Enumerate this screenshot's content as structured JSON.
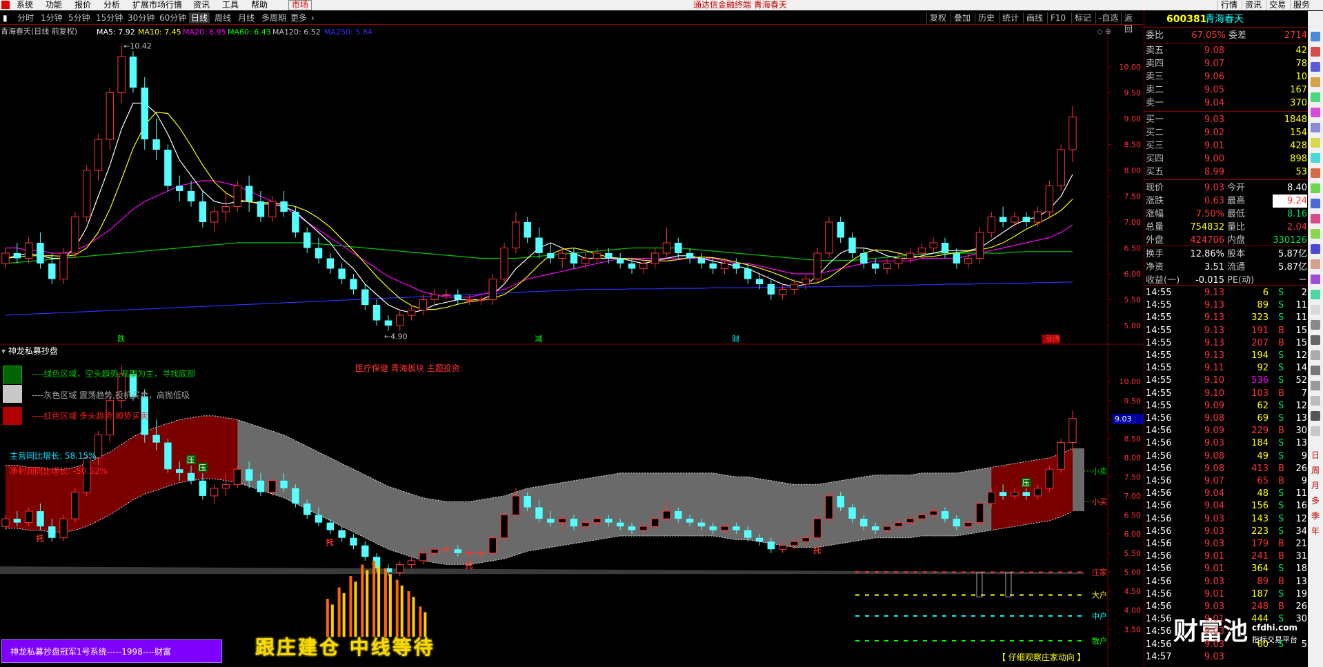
{
  "menubar": {
    "items": [
      "系统",
      "功能",
      "报价",
      "分析",
      "扩展市场行情",
      "资讯",
      "工具",
      "帮助",
      "市场"
    ],
    "title": "通达信金融终端 青海春天",
    "right_items": [
      "行情",
      "资讯",
      "交易",
      "服务"
    ]
  },
  "periodbar": {
    "periods": [
      "分时",
      "1分钟",
      "5分钟",
      "15分钟",
      "30分钟",
      "60分钟",
      "日线",
      "周线",
      "月线",
      "多周期",
      "更多"
    ],
    "active": "日线",
    "tools": [
      "复权",
      "叠加",
      "历史",
      "统计",
      "画线",
      "F10",
      "标记",
      "-自选",
      "返回"
    ]
  },
  "upper": {
    "stock_title": "青海春天(日线 前复权)",
    "ma": [
      {
        "label": "MA5: 7.92",
        "color": "#ffffff"
      },
      {
        "label": "MA10: 7.45",
        "color": "#ffff00"
      },
      {
        "label": "MA20: 6.95",
        "color": "#ff00ff"
      },
      {
        "label": "MA60: 6.43",
        "color": "#00ff00"
      },
      {
        "label": "MA120: 6.52",
        "color": "#c0c0c0"
      },
      {
        "label": "MA250: 5.84",
        "color": "#3030ff"
      }
    ],
    "axis": [
      "10.00",
      "9.50",
      "9.00",
      "8.50",
      "8.00",
      "7.50",
      "7.00",
      "6.50",
      "6.00",
      "5.50",
      "5.00"
    ],
    "high_label": "10.42",
    "low_label": "4.90",
    "signals": [
      {
        "text": "跌",
        "color": "#00ff00"
      },
      {
        "text": "减",
        "color": "#00ff00"
      },
      {
        "text": "财",
        "color": "#00ffff"
      },
      {
        "text": "涨腾",
        "color": "#ff3333"
      }
    ]
  },
  "lower": {
    "indicator_name": "神龙私募抄盘",
    "sector_note": "医疗保健 青海板块 主题投资:",
    "legend": [
      {
        "text": "----绿色区域，空头趋势,观望为主，寻找底部",
        "color": "#00c800",
        "swatch": "#006400"
      },
      {
        "text": "----灰色区域 震荡趋势,投机买卖，高抛低吸",
        "color": "#a0a0a0",
        "swatch": "#c8c8c8"
      },
      {
        "text": "----红色区域 多头趋势,顺势买卖",
        "color": "#ff2020",
        "swatch": "#b00000"
      }
    ],
    "growth1": "主营同比增长: 58.15%",
    "growth2": "净利润同比增长: -50.52%",
    "axis": [
      "10.00",
      "9.50",
      "9.00",
      "8.50",
      "8.00",
      "7.50",
      "7.00",
      "6.50",
      "6.00",
      "5.50",
      "5.00",
      "4.50",
      "4.00",
      "3.50"
    ],
    "price_tag": "9.03",
    "band_labels": [
      "小卖",
      "小买",
      "庄家",
      "大户",
      "中户",
      "散户"
    ],
    "marks_tuo": [
      "托",
      "托",
      "托",
      "托"
    ],
    "marks_ya": [
      "压",
      "压",
      "压"
    ],
    "banner_left": "神龙私募抄盘冠军1号系统-----1998----财富",
    "banner_mid": "跟庄建仓 中线等待",
    "bottom_note": "【 仔细观察庄家动向 】"
  },
  "quote": {
    "code": "600381",
    "name": "青海春天",
    "weibi_label": "委比",
    "weibi": "67.05%",
    "weicha_label": "委差",
    "weicha": "2714",
    "sell": [
      {
        "label": "卖五",
        "price": "9.08",
        "vol": "42"
      },
      {
        "label": "卖四",
        "price": "9.07",
        "vol": "78"
      },
      {
        "label": "卖三",
        "price": "9.06",
        "vol": "10"
      },
      {
        "label": "卖二",
        "price": "9.05",
        "vol": "167"
      },
      {
        "label": "卖一",
        "price": "9.04",
        "vol": "370"
      }
    ],
    "buy": [
      {
        "label": "买一",
        "price": "9.03",
        "vol": "1848"
      },
      {
        "label": "买二",
        "price": "9.02",
        "vol": "154"
      },
      {
        "label": "买三",
        "price": "9.01",
        "vol": "428"
      },
      {
        "label": "买四",
        "price": "9.00",
        "vol": "898"
      },
      {
        "label": "买五",
        "price": "8.99",
        "vol": "53"
      }
    ],
    "stats": [
      {
        "l1": "现价",
        "v1": "9.03",
        "c1": "#ff3333",
        "l2": "今开",
        "v2": "8.40",
        "c2": "#ffffff"
      },
      {
        "l1": "涨跌",
        "v1": "0.63",
        "c1": "#ff3333",
        "l2": "最高",
        "v2": "9.24",
        "c2": "#ff3333"
      },
      {
        "l1": "涨幅",
        "v1": "7.50%",
        "c1": "#ff3333",
        "l2": "最低",
        "v2": "8.16",
        "c2": "#00e060"
      },
      {
        "l1": "总量",
        "v1": "754832",
        "c1": "#ffff00",
        "l2": "量比",
        "v2": "2.04",
        "c2": "#ff3333"
      },
      {
        "l1": "外盘",
        "v1": "424706",
        "c1": "#ff3333",
        "l2": "内盘",
        "v2": "330126",
        "c2": "#00e060"
      }
    ],
    "stats2": [
      {
        "l1": "换手",
        "v1": "12.86%",
        "l2": "股本",
        "v2": "5.87亿"
      },
      {
        "l1": "净资",
        "v1": "3.51",
        "l2": "流通",
        "v2": "5.87亿"
      },
      {
        "l1": "收益(一)",
        "v1": "-0.015",
        "l2": "PE(动)",
        "v2": "－"
      }
    ],
    "ticks": [
      [
        "14:55",
        "9.13",
        "6",
        "S",
        "2"
      ],
      [
        "14:55",
        "9.13",
        "89",
        "S",
        "11"
      ],
      [
        "14:55",
        "9.13",
        "323",
        "S",
        "11"
      ],
      [
        "14:55",
        "9.13",
        "191",
        "B",
        "15"
      ],
      [
        "14:55",
        "9.13",
        "207",
        "B",
        "15"
      ],
      [
        "14:55",
        "9.13",
        "194",
        "S",
        "12"
      ],
      [
        "14:55",
        "9.11",
        "92",
        "S",
        "14"
      ],
      [
        "14:55",
        "9.10",
        "536",
        "S",
        "52"
      ],
      [
        "14:55",
        "9.10",
        "103",
        "B",
        "7"
      ],
      [
        "14:55",
        "9.09",
        "62",
        "S",
        "12"
      ],
      [
        "14:56",
        "9.08",
        "69",
        "S",
        "13"
      ],
      [
        "14:56",
        "9.09",
        "229",
        "B",
        "30"
      ],
      [
        "14:56",
        "9.03",
        "184",
        "S",
        "13"
      ],
      [
        "14:56",
        "9.08",
        "49",
        "S",
        "9"
      ],
      [
        "14:56",
        "9.08",
        "413",
        "B",
        "26"
      ],
      [
        "14:56",
        "9.07",
        "65",
        "B",
        "9"
      ],
      [
        "14:56",
        "9.04",
        "48",
        "S",
        "11"
      ],
      [
        "14:56",
        "9.04",
        "156",
        "S",
        "16"
      ],
      [
        "14:56",
        "9.03",
        "143",
        "S",
        "12"
      ],
      [
        "14:56",
        "9.03",
        "223",
        "S",
        "34"
      ],
      [
        "14:56",
        "9.03",
        "179",
        "B",
        "21"
      ],
      [
        "14:56",
        "9.01",
        "241",
        "B",
        "31"
      ],
      [
        "14:56",
        "9.01",
        "364",
        "S",
        "18"
      ],
      [
        "14:56",
        "9.03",
        "89",
        "B",
        "13"
      ],
      [
        "14:56",
        "9.01",
        "187",
        "S",
        "19"
      ],
      [
        "14:56",
        "9.03",
        "248",
        "B",
        "26"
      ],
      [
        "14:56",
        "9.01",
        "444",
        "S",
        "30"
      ],
      [
        "14:56",
        "9.03",
        "",
        "",
        ""
      ],
      [
        "14:56",
        "9.03",
        "60",
        "S",
        "5"
      ],
      [
        "14:57",
        "9.03",
        "",
        "",
        ""
      ]
    ],
    "watermark": "财富池",
    "watermark_url": "cfdhi.com",
    "watermark_sub": "指标交易平台"
  },
  "sidebar": {
    "labels": [
      "日",
      "周",
      "月",
      "多",
      "季",
      "年"
    ]
  },
  "colors": {
    "up": "#ff3333",
    "down": "#54ffff",
    "grid_red": "#800000",
    "red_zone": "#7a0000",
    "gray_zone": "#6a6a6a"
  },
  "chart_data": {
    "type": "candlestick",
    "y_range": [
      4.8,
      10.6
    ],
    "candles": [
      [
        6.2,
        6.5,
        6.1,
        6.4
      ],
      [
        6.4,
        6.6,
        6.2,
        6.3
      ],
      [
        6.3,
        6.7,
        6.2,
        6.6
      ],
      [
        6.6,
        6.8,
        6.1,
        6.2
      ],
      [
        6.2,
        6.4,
        5.8,
        5.9
      ],
      [
        5.9,
        6.5,
        5.8,
        6.4
      ],
      [
        6.4,
        7.2,
        6.3,
        7.1
      ],
      [
        7.1,
        8.1,
        7.0,
        8.0
      ],
      [
        8.0,
        8.7,
        7.8,
        8.6
      ],
      [
        8.6,
        9.6,
        8.4,
        9.5
      ],
      [
        9.5,
        10.42,
        9.3,
        10.2
      ],
      [
        10.2,
        10.3,
        9.5,
        9.6
      ],
      [
        9.6,
        9.8,
        8.4,
        8.6
      ],
      [
        8.6,
        9.0,
        8.2,
        8.4
      ],
      [
        8.4,
        8.5,
        7.6,
        7.7
      ],
      [
        7.7,
        7.9,
        7.4,
        7.6
      ],
      [
        7.6,
        7.8,
        7.3,
        7.4
      ],
      [
        7.4,
        7.6,
        6.9,
        7.0
      ],
      [
        7.0,
        7.3,
        6.8,
        7.2
      ],
      [
        7.2,
        7.6,
        7.0,
        7.3
      ],
      [
        7.3,
        7.8,
        7.2,
        7.7
      ],
      [
        7.7,
        7.9,
        7.2,
        7.4
      ],
      [
        7.4,
        7.6,
        7.0,
        7.1
      ],
      [
        7.1,
        7.5,
        7.0,
        7.4
      ],
      [
        7.4,
        7.6,
        7.1,
        7.2
      ],
      [
        7.2,
        7.3,
        6.7,
        6.8
      ],
      [
        6.8,
        6.9,
        6.4,
        6.5
      ],
      [
        6.5,
        6.7,
        6.2,
        6.3
      ],
      [
        6.3,
        6.4,
        6.0,
        6.1
      ],
      [
        6.1,
        6.2,
        5.8,
        5.9
      ],
      [
        5.9,
        6.0,
        5.6,
        5.7
      ],
      [
        5.7,
        5.8,
        5.3,
        5.4
      ],
      [
        5.4,
        5.5,
        5.0,
        5.1
      ],
      [
        5.1,
        5.2,
        4.9,
        5.0
      ],
      [
        5.0,
        5.3,
        4.9,
        5.2
      ],
      [
        5.2,
        5.4,
        5.1,
        5.3
      ],
      [
        5.3,
        5.6,
        5.2,
        5.5
      ],
      [
        5.5,
        5.7,
        5.4,
        5.6
      ],
      [
        5.6,
        5.7,
        5.5,
        5.6
      ],
      [
        5.6,
        5.7,
        5.4,
        5.5
      ],
      [
        5.5,
        5.6,
        5.4,
        5.5
      ],
      [
        5.5,
        5.6,
        5.4,
        5.5
      ],
      [
        5.5,
        6.0,
        5.4,
        5.9
      ],
      [
        5.9,
        6.6,
        5.8,
        6.5
      ],
      [
        6.5,
        7.2,
        6.4,
        7.0
      ],
      [
        7.0,
        7.1,
        6.6,
        6.7
      ],
      [
        6.7,
        6.9,
        6.3,
        6.4
      ],
      [
        6.4,
        6.6,
        6.2,
        6.3
      ],
      [
        6.3,
        6.5,
        6.1,
        6.4
      ],
      [
        6.4,
        6.5,
        6.1,
        6.2
      ],
      [
        6.2,
        6.4,
        6.1,
        6.3
      ],
      [
        6.3,
        6.5,
        6.2,
        6.4
      ],
      [
        6.4,
        6.5,
        6.2,
        6.3
      ],
      [
        6.3,
        6.4,
        6.1,
        6.2
      ],
      [
        6.2,
        6.3,
        6.0,
        6.1
      ],
      [
        6.1,
        6.3,
        6.0,
        6.2
      ],
      [
        6.2,
        6.5,
        6.1,
        6.4
      ],
      [
        6.4,
        6.9,
        6.3,
        6.6
      ],
      [
        6.6,
        6.7,
        6.3,
        6.4
      ],
      [
        6.4,
        6.5,
        6.2,
        6.3
      ],
      [
        6.3,
        6.4,
        6.1,
        6.2
      ],
      [
        6.2,
        6.3,
        6.0,
        6.1
      ],
      [
        6.1,
        6.3,
        6.0,
        6.2
      ],
      [
        6.2,
        6.3,
        6.0,
        6.1
      ],
      [
        6.1,
        6.2,
        5.8,
        5.9
      ],
      [
        5.9,
        6.0,
        5.7,
        5.8
      ],
      [
        5.8,
        5.9,
        5.5,
        5.6
      ],
      [
        5.6,
        5.8,
        5.5,
        5.7
      ],
      [
        5.7,
        5.9,
        5.6,
        5.8
      ],
      [
        5.8,
        6.0,
        5.7,
        5.9
      ],
      [
        5.9,
        6.5,
        5.8,
        6.4
      ],
      [
        6.4,
        7.1,
        6.3,
        7.0
      ],
      [
        7.0,
        7.1,
        6.6,
        6.7
      ],
      [
        6.7,
        6.8,
        6.3,
        6.4
      ],
      [
        6.4,
        6.5,
        6.1,
        6.2
      ],
      [
        6.2,
        6.3,
        6.0,
        6.1
      ],
      [
        6.1,
        6.3,
        6.0,
        6.2
      ],
      [
        6.2,
        6.4,
        6.1,
        6.3
      ],
      [
        6.3,
        6.5,
        6.2,
        6.4
      ],
      [
        6.4,
        6.6,
        6.3,
        6.5
      ],
      [
        6.5,
        6.7,
        6.4,
        6.6
      ],
      [
        6.6,
        6.7,
        6.3,
        6.4
      ],
      [
        6.4,
        6.5,
        6.1,
        6.2
      ],
      [
        6.2,
        6.4,
        6.1,
        6.3
      ],
      [
        6.3,
        6.9,
        6.2,
        6.8
      ],
      [
        6.8,
        7.2,
        6.7,
        7.1
      ],
      [
        7.1,
        7.3,
        6.9,
        7.0
      ],
      [
        7.0,
        7.2,
        6.9,
        7.1
      ],
      [
        7.1,
        7.2,
        6.9,
        7.0
      ],
      [
        7.0,
        7.3,
        6.9,
        7.2
      ],
      [
        7.2,
        7.8,
        7.1,
        7.7
      ],
      [
        7.7,
        8.5,
        7.6,
        8.4
      ],
      [
        8.4,
        9.24,
        8.16,
        9.03
      ]
    ],
    "ma5": [
      6.3,
      6.35,
      6.4,
      6.35,
      6.3,
      6.3,
      6.5,
      6.9,
      7.5,
      8.1,
      8.8,
      9.3,
      9.3,
      9.1,
      8.7,
      8.2,
      7.9,
      7.6,
      7.4,
      7.35,
      7.4,
      7.4,
      7.35,
      7.35,
      7.3,
      7.2,
      7.0,
      6.8,
      6.6,
      6.3,
      6.1,
      5.8,
      5.6,
      5.4,
      5.3,
      5.25,
      5.3,
      5.4,
      5.45,
      5.5,
      5.5,
      5.5,
      5.6,
      5.8,
      6.1,
      6.3,
      6.5,
      6.6,
      6.5,
      6.4,
      6.3,
      6.3,
      6.3,
      6.3,
      6.25,
      6.2,
      6.25,
      6.3,
      6.35,
      6.35,
      6.3,
      6.25,
      6.2,
      6.15,
      6.1,
      6.0,
      5.9,
      5.8,
      5.75,
      5.8,
      5.95,
      6.2,
      6.4,
      6.5,
      6.5,
      6.45,
      6.35,
      6.3,
      6.3,
      6.35,
      6.4,
      6.45,
      6.45,
      6.45,
      6.5,
      6.65,
      6.8,
      6.95,
      7.05,
      7.1,
      7.25,
      7.5,
      7.92
    ],
    "ma20": [
      6.5,
      6.5,
      6.45,
      6.45,
      6.4,
      6.4,
      6.45,
      6.55,
      6.7,
      6.85,
      7.05,
      7.25,
      7.4,
      7.5,
      7.6,
      7.7,
      7.75,
      7.8,
      7.8,
      7.75,
      7.7,
      7.6,
      7.5,
      7.4,
      7.3,
      7.15,
      7.0,
      6.85,
      6.7,
      6.55,
      6.4,
      6.25,
      6.1,
      5.95,
      5.85,
      5.75,
      5.65,
      5.6,
      5.55,
      5.55,
      5.55,
      5.6,
      5.65,
      5.7,
      5.8,
      5.9,
      5.95,
      6.0,
      6.05,
      6.1,
      6.15,
      6.2,
      6.25,
      6.3,
      6.3,
      6.3,
      6.3,
      6.3,
      6.3,
      6.3,
      6.3,
      6.3,
      6.25,
      6.2,
      6.2,
      6.15,
      6.1,
      6.05,
      6.0,
      6.0,
      6.0,
      6.05,
      6.1,
      6.15,
      6.2,
      6.25,
      6.25,
      6.25,
      6.25,
      6.3,
      6.3,
      6.3,
      6.3,
      6.35,
      6.4,
      6.45,
      6.5,
      6.55,
      6.6,
      6.65,
      6.7,
      6.8,
      6.95
    ],
    "ma60": [
      6.2,
      6.22,
      6.24,
      6.26,
      6.28,
      6.3,
      6.32,
      6.34,
      6.36,
      6.38,
      6.4,
      6.42,
      6.44,
      6.46,
      6.48,
      6.5,
      6.52,
      6.54,
      6.56,
      6.58,
      6.6,
      6.6,
      6.6,
      6.6,
      6.6,
      6.6,
      6.6,
      6.58,
      6.56,
      6.54,
      6.52,
      6.5,
      6.48,
      6.46,
      6.44,
      6.42,
      6.4,
      6.38,
      6.36,
      6.34,
      6.32,
      6.3,
      6.3,
      6.3,
      6.3,
      6.32,
      6.34,
      6.36,
      6.38,
      6.4,
      6.42,
      6.44,
      6.46,
      6.48,
      6.5,
      6.5,
      6.5,
      6.5,
      6.5,
      6.48,
      6.46,
      6.44,
      6.42,
      6.4,
      6.38,
      6.36,
      6.34,
      6.32,
      6.3,
      6.28,
      6.26,
      6.26,
      6.26,
      6.26,
      6.28,
      6.3,
      6.32,
      6.34,
      6.36,
      6.38,
      6.4,
      6.4,
      6.4,
      6.4,
      6.4,
      6.4,
      6.4,
      6.42,
      6.43,
      6.43,
      6.43,
      6.43,
      6.43
    ],
    "ma250": [
      5.2,
      5.21,
      5.22,
      5.23,
      5.24,
      5.25,
      5.26,
      5.27,
      5.28,
      5.29,
      5.3,
      5.31,
      5.32,
      5.33,
      5.34,
      5.35,
      5.36,
      5.37,
      5.38,
      5.39,
      5.4,
      5.41,
      5.42,
      5.43,
      5.44,
      5.45,
      5.46,
      5.47,
      5.48,
      5.49,
      5.5,
      5.51,
      5.52,
      5.53,
      5.54,
      5.55,
      5.56,
      5.57,
      5.58,
      5.59,
      5.6,
      5.61,
      5.62,
      5.63,
      5.64,
      5.65,
      5.66,
      5.67,
      5.68,
      5.69,
      5.7,
      5.7,
      5.7,
      5.7,
      5.71,
      5.71,
      5.71,
      5.72,
      5.72,
      5.72,
      5.72,
      5.73,
      5.73,
      5.73,
      5.73,
      5.74,
      5.74,
      5.74,
      5.74,
      5.75,
      5.75,
      5.75,
      5.76,
      5.76,
      5.76,
      5.77,
      5.77,
      5.78,
      5.78,
      5.79,
      5.79,
      5.8,
      5.8,
      5.8,
      5.81,
      5.81,
      5.82,
      5.82,
      5.82,
      5.83,
      5.83,
      5.84,
      5.84
    ]
  }
}
